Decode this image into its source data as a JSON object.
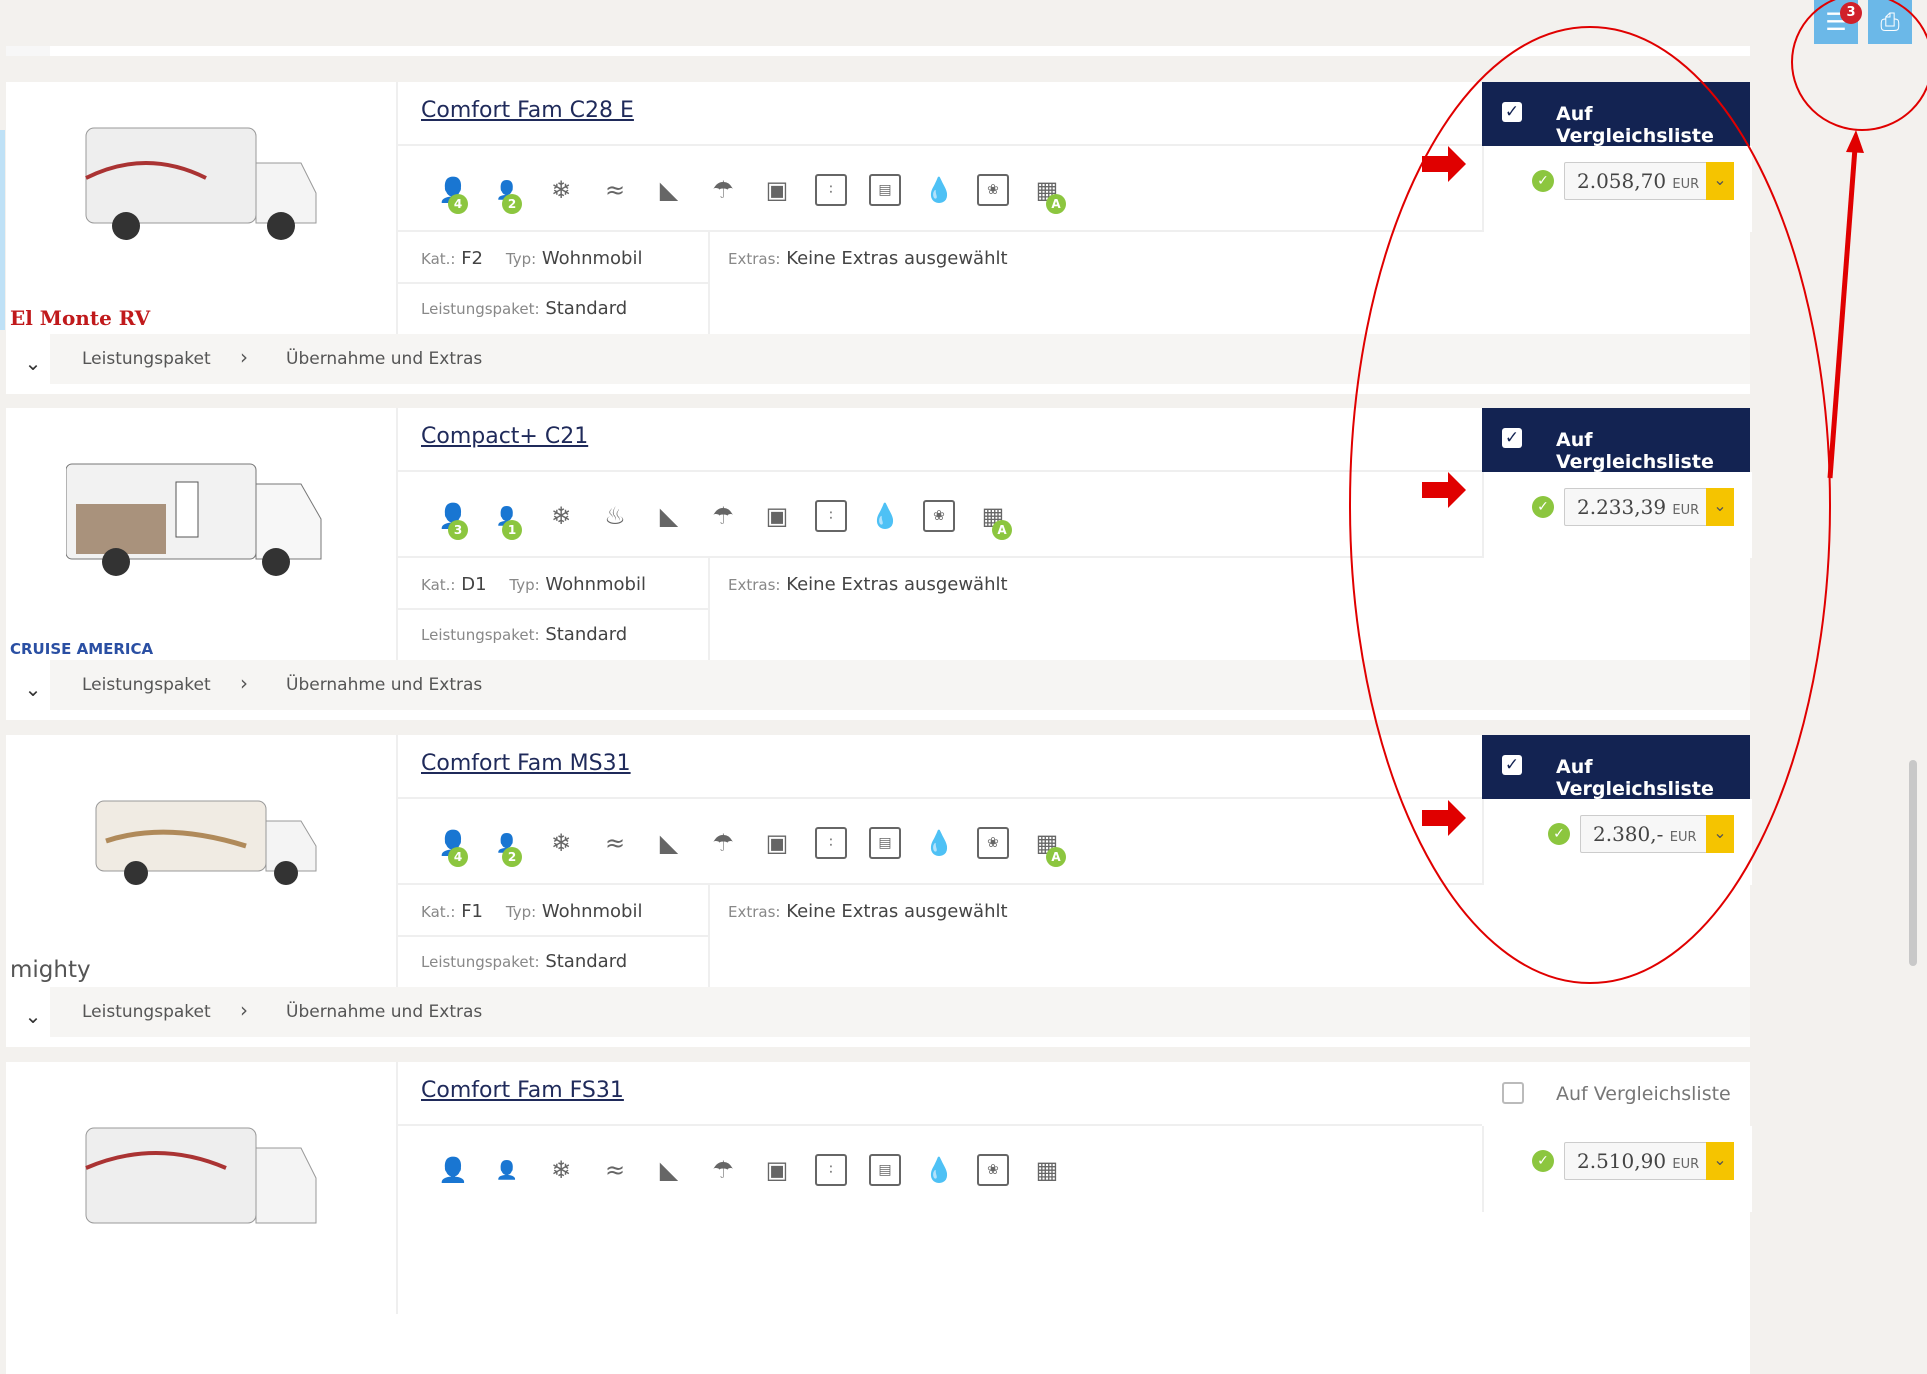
{
  "header": {
    "list_badge_count": "3",
    "list_icon": "list-icon",
    "print_icon": "print-icon"
  },
  "cards": [
    {
      "title": "Comfort Fam C28 E",
      "logo": "El Monte RV",
      "compare_label": "Auf Vergleichsliste",
      "compare_checked": true,
      "price": "2.058,70",
      "currency": "EUR",
      "persons_adult": "4",
      "persons_child": "2",
      "kat_label": "Kat.:",
      "kat_value": "F2",
      "typ_label": "Typ:",
      "typ_value": "Wohnmobil",
      "extras_label": "Extras:",
      "extras_value": "Keine Extras ausgewählt",
      "leist_label": "Leistungspaket:",
      "leist_value": "Standard",
      "foot_leist": "Leistungspaket",
      "foot_extras": "Übernahme und Extras"
    },
    {
      "title": "Compact+ C21",
      "logo": "CRUISE AMERICA",
      "compare_label": "Auf Vergleichsliste",
      "compare_checked": true,
      "price": "2.233,39",
      "currency": "EUR",
      "persons_adult": "3",
      "persons_child": "1",
      "kat_label": "Kat.:",
      "kat_value": "D1",
      "typ_label": "Typ:",
      "typ_value": "Wohnmobil",
      "extras_label": "Extras:",
      "extras_value": "Keine Extras ausgewählt",
      "leist_label": "Leistungspaket:",
      "leist_value": "Standard",
      "foot_leist": "Leistungspaket",
      "foot_extras": "Übernahme und Extras"
    },
    {
      "title": "Comfort Fam MS31",
      "logo": "mighty",
      "compare_label": "Auf Vergleichsliste",
      "compare_checked": true,
      "price": "2.380,-",
      "currency": "EUR",
      "persons_adult": "4",
      "persons_child": "2",
      "kat_label": "Kat.:",
      "kat_value": "F1",
      "typ_label": "Typ:",
      "typ_value": "Wohnmobil",
      "extras_label": "Extras:",
      "extras_value": "Keine Extras ausgewählt",
      "leist_label": "Leistungspaket:",
      "leist_value": "Standard",
      "foot_leist": "Leistungspaket",
      "foot_extras": "Übernahme und Extras"
    },
    {
      "title": "Comfort Fam FS31",
      "compare_label": "Auf Vergleichsliste",
      "compare_checked": false,
      "price": "2.510,90",
      "currency": "EUR"
    }
  ],
  "colors": {
    "compare_active_bg": "#132352",
    "ok_green": "#8cc63f",
    "dropdown_yellow": "#f5c400",
    "annotation_red": "#e00000",
    "top_button_blue": "#6bb8e8"
  }
}
